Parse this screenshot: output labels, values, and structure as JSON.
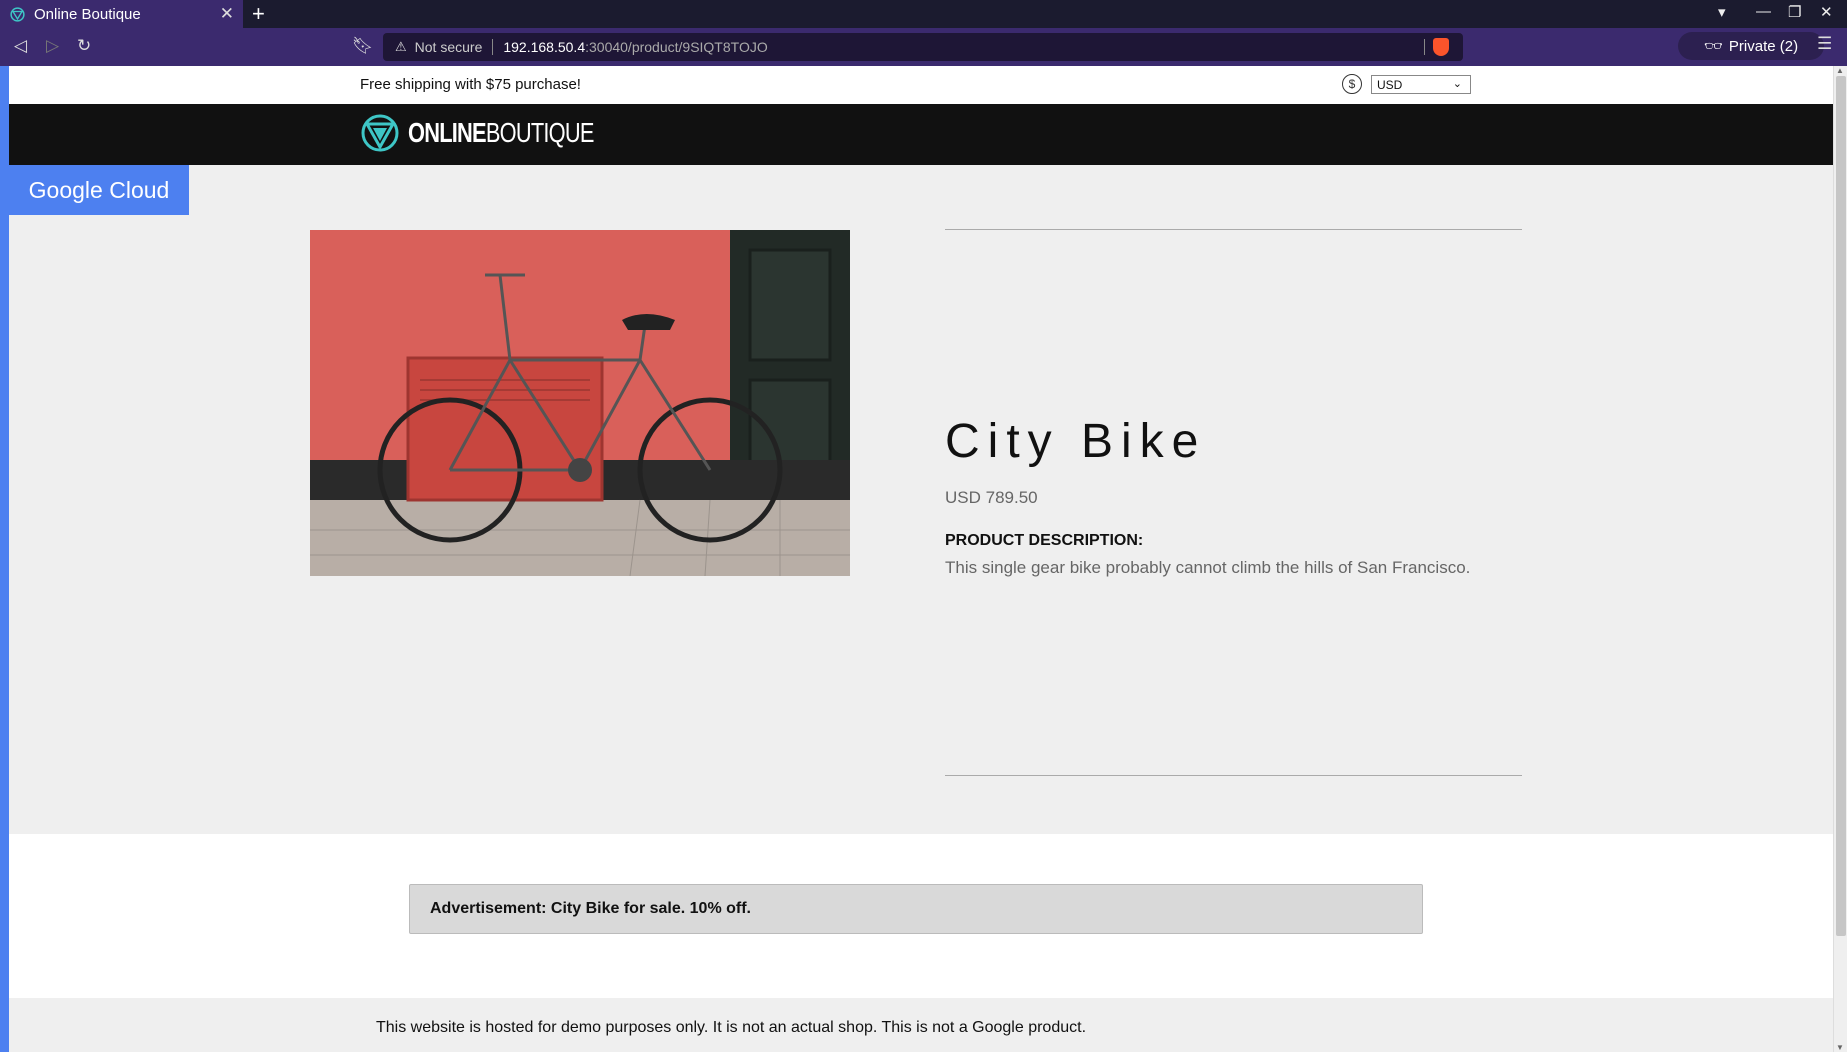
{
  "browser": {
    "tab_title": "Online Boutique",
    "url_security": "Not secure",
    "url_host": "192.168.50.4",
    "url_path": ":30040/product/9SIQT8TOJO",
    "private_label": "Private (2)"
  },
  "topbar": {
    "shipping_text": "Free shipping with $75 purchase!",
    "currency_symbol": "$",
    "currency_selected": "USD"
  },
  "header": {
    "brand_bold": "ONLINE",
    "brand_light": "BOUTIQUE"
  },
  "banner": {
    "label": "Google Cloud"
  },
  "product": {
    "name": "City Bike",
    "price": "USD 789.50",
    "description_label": "PRODUCT DESCRIPTION:",
    "description": "This single gear bike probably cannot climb the hills of San Francisco.",
    "image_alt": "city-bike-photo"
  },
  "ad": {
    "text": "Advertisement: City Bike for sale. 10% off."
  },
  "footer": {
    "text": "This website is hosted for demo purposes only. It is not an actual shop. This is not a Google product."
  },
  "colors": {
    "accent_blue": "#4d80f0",
    "brand_teal": "#3ec6c6",
    "browser_purple": "#3b2a6e"
  }
}
